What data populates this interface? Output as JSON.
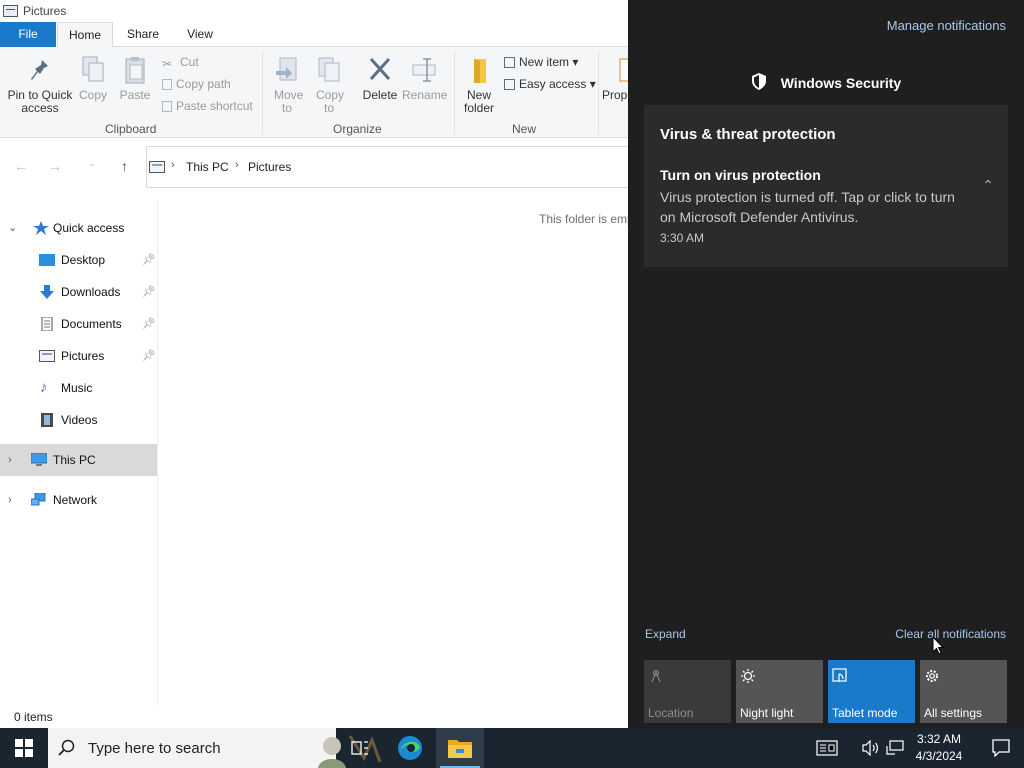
{
  "window": {
    "title": "Pictures"
  },
  "ribbon": {
    "tabs": [
      "File",
      "Home",
      "Share",
      "View"
    ],
    "clipboard": {
      "group_label": "Clipboard",
      "pin_to_quick_access": "Pin to Quick access",
      "copy": "Copy",
      "paste": "Paste",
      "cut": "Cut",
      "copy_path": "Copy path",
      "paste_shortcut": "Paste shortcut"
    },
    "organize": {
      "group_label": "Organize",
      "move_to": "Move to",
      "copy_to": "Copy to",
      "delete": "Delete",
      "rename": "Rename"
    },
    "new": {
      "group_label": "New",
      "new_folder": "New folder",
      "new_item": "New item",
      "easy_access": "Easy access"
    },
    "open": {
      "properties_partial": "Prop"
    }
  },
  "address": {
    "crumbs": [
      "This PC",
      "Pictures"
    ]
  },
  "nav": {
    "quick_access": "Quick access",
    "items": [
      "Desktop",
      "Downloads",
      "Documents",
      "Pictures",
      "Music",
      "Videos"
    ],
    "this_pc": "This PC",
    "network": "Network"
  },
  "content": {
    "empty_message": "This folder is empty."
  },
  "status": {
    "items": "0 items"
  },
  "action_center": {
    "manage": "Manage notifications",
    "app_name": "Windows Security",
    "notification": {
      "heading": "Virus & threat protection",
      "title": "Turn on virus protection",
      "body": "Virus protection is turned off. Tap or click to turn on Microsoft Defender Antivirus.",
      "time": "3:30 AM"
    },
    "expand": "Expand",
    "clear_all": "Clear all notifications",
    "quick_actions": [
      {
        "label": "Location",
        "state": "off",
        "icon": "location-icon"
      },
      {
        "label": "Night light",
        "state": "normal",
        "icon": "night-light-icon"
      },
      {
        "label": "Tablet mode",
        "state": "on",
        "icon": "tablet-mode-icon"
      },
      {
        "label": "All settings",
        "state": "normal",
        "icon": "gear-icon"
      }
    ]
  },
  "taskbar": {
    "search_placeholder": "Type here to search",
    "clock_time": "3:32 AM",
    "clock_date": "4/3/2024"
  },
  "colors": {
    "accent": "#1979ca",
    "action_center_bg": "#1f1f1f",
    "card_bg": "#2b2b2b",
    "link": "#a8c8e8",
    "taskbar_bg": "#1a2530"
  }
}
